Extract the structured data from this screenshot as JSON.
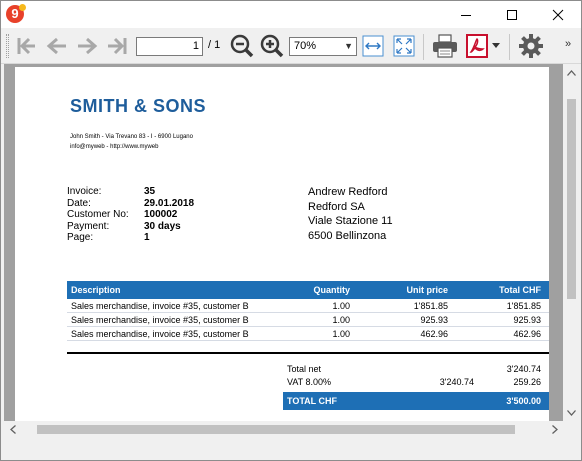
{
  "window": {
    "app_icon_text": "9",
    "controls": {
      "minimize": "minimize",
      "maximize": "maximize",
      "close": "close"
    }
  },
  "toolbar": {
    "icons": [
      "first-page-icon",
      "previous-page-icon",
      "next-page-icon",
      "last-page-icon",
      "zoom-out-icon",
      "zoom-in-icon",
      "fit-width-icon",
      "fit-page-icon",
      "print-icon",
      "pdf-icon",
      "settings-icon"
    ],
    "page_current": "1",
    "page_total": "/ 1",
    "zoom_value": "70%",
    "overflow_label": "»"
  },
  "invoice": {
    "company": {
      "name": "SMITH & SONS",
      "address_line": "John  Smith - Via Trevano 83 - I - 6900 Lugano",
      "web_line": "info@myweb - http://www.myweb"
    },
    "meta": [
      {
        "label": "Invoice:",
        "value": "35"
      },
      {
        "label": "Date:",
        "value": "29.01.2018"
      },
      {
        "label": "Customer No:",
        "value": "100002"
      },
      {
        "label": "Payment:",
        "value": "30 days"
      },
      {
        "label": "Page:",
        "value": "1"
      }
    ],
    "recipient": [
      "Andrew Redford",
      "Redford SA",
      "Viale Stazione 11",
      "6500 Bellinzona"
    ],
    "table": {
      "headers": {
        "description": "Description",
        "quantity": "Quantity",
        "unit_price": "Unit price",
        "total": "Total CHF"
      },
      "rows": [
        {
          "description": "Sales merchandise, invoice #35, customer B",
          "quantity": "1.00",
          "unit_price": "1'851.85",
          "total": "1'851.85"
        },
        {
          "description": "Sales merchandise, invoice #35, customer B",
          "quantity": "1.00",
          "unit_price": "925.93",
          "total": "925.93"
        },
        {
          "description": "Sales merchandise, invoice #35, customer B",
          "quantity": "1.00",
          "unit_price": "462.96",
          "total": "462.96"
        }
      ]
    },
    "totals": {
      "net_label": "Total net",
      "net_value": "3'240.74",
      "vat_label": "VAT 8.00%",
      "vat_base": "3'240.74",
      "vat_value": "259.26",
      "grand_label": "TOTAL CHF",
      "grand_value": "3'500.00"
    }
  },
  "colors": {
    "accent": "#1e6fb5",
    "company_name": "#1e5d9b",
    "app_icon": "#e8412a",
    "pdf_icon": "#c8102e"
  }
}
